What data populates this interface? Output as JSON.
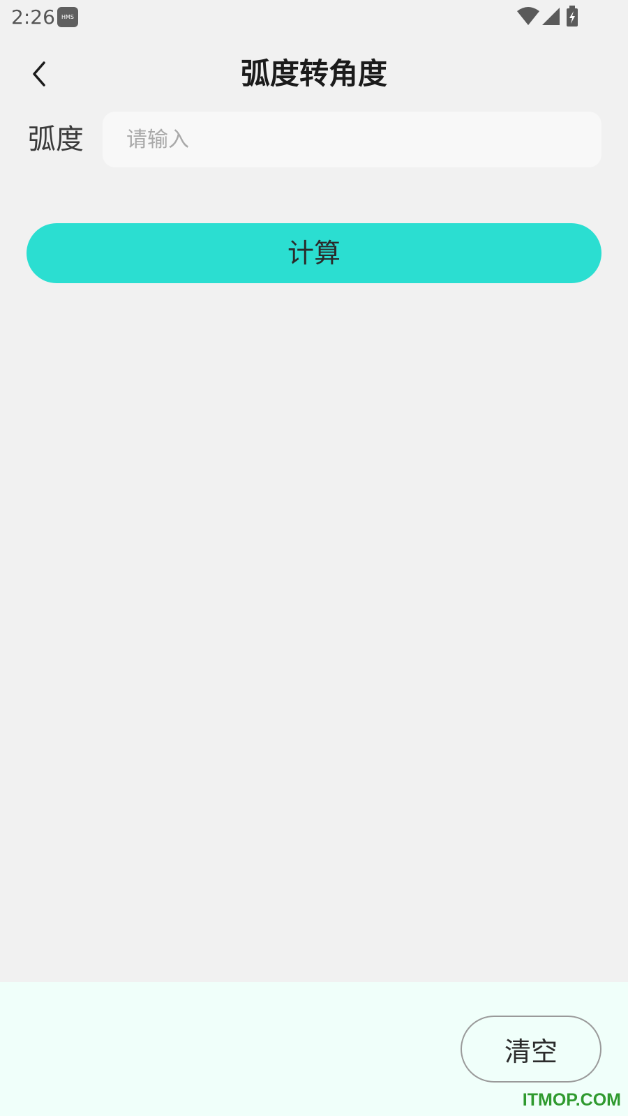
{
  "status_bar": {
    "time": "2:26",
    "badge": "HMS",
    "icons": [
      "wifi-icon",
      "cellular-signal-icon",
      "battery-charging-icon"
    ]
  },
  "header": {
    "title": "弧度转角度",
    "back_icon": "chevron-left-icon"
  },
  "form": {
    "label": "弧度",
    "input_value": "",
    "input_placeholder": "请输入"
  },
  "actions": {
    "calculate_label": "计算",
    "clear_label": "清空"
  },
  "watermark": "ITMOP.COM",
  "colors": {
    "accent": "#2bded1",
    "background": "#f1f1f1",
    "bottom_panel": "#f0fffa",
    "watermark": "#2f9a2f"
  }
}
